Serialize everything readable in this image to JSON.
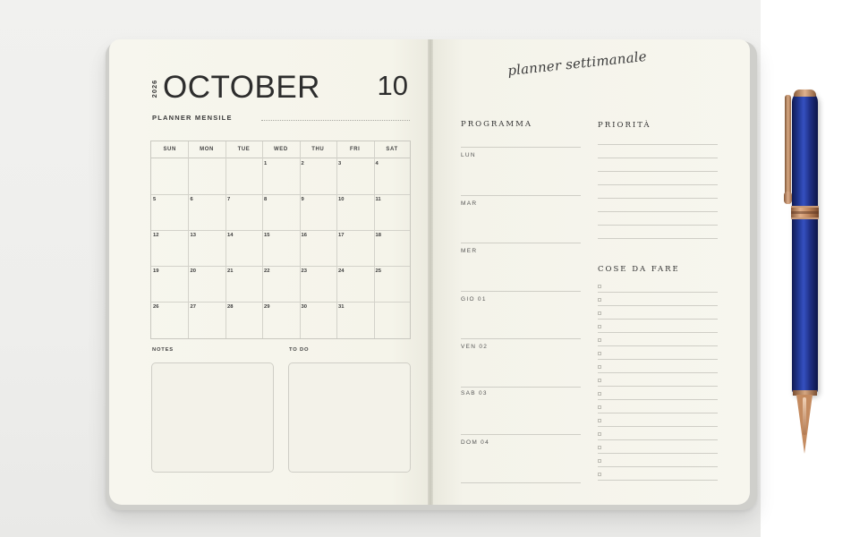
{
  "left_page": {
    "year": "2026",
    "month": "OCTOBER",
    "month_number": "10",
    "subtitle": "PLANNER MENSILE",
    "weekdays": [
      "SUN",
      "MON",
      "TUE",
      "WED",
      "THU",
      "FRI",
      "SAT"
    ],
    "weeks": [
      [
        "",
        "",
        "",
        "1",
        "2",
        "3",
        "4"
      ],
      [
        "5",
        "6",
        "7",
        "8",
        "9",
        "10",
        "11"
      ],
      [
        "12",
        "13",
        "14",
        "15",
        "16",
        "17",
        "18"
      ],
      [
        "19",
        "20",
        "21",
        "22",
        "23",
        "24",
        "25"
      ],
      [
        "26",
        "27",
        "28",
        "29",
        "30",
        "31",
        ""
      ]
    ],
    "notes_label": "NOTES",
    "todo_label": "TO DO"
  },
  "right_page": {
    "script_title": "planner settimanale",
    "programma_label": "PROGRAMMA",
    "priorita_label": "PRIORITÀ",
    "cose_da_fare_label": "COSE DA FARE",
    "days": [
      "LUN",
      "MAR",
      "MER",
      "GIO 01",
      "VEN 02",
      "SAB 03",
      "DOM 04"
    ]
  },
  "colors": {
    "paper": "#f6f5ec",
    "ink": "#2d2d2d",
    "pen_blue": "#233a9a",
    "rose_gold": "#c48b60"
  }
}
